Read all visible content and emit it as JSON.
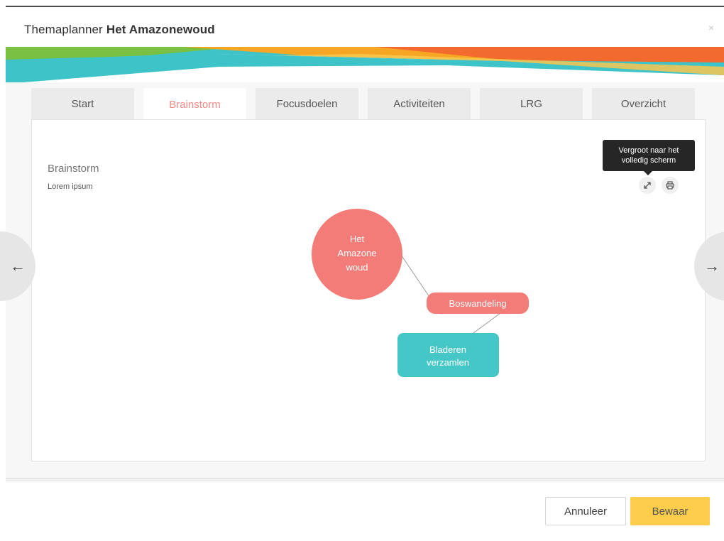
{
  "header": {
    "title_prefix": "Themaplanner",
    "title_main": "Het Amazonewoud",
    "close_label": "×"
  },
  "tabs": [
    {
      "label": "Start"
    },
    {
      "label": "Brainstorm"
    },
    {
      "label": "Focusdoelen"
    },
    {
      "label": "Activiteiten"
    },
    {
      "label": "LRG"
    },
    {
      "label": "Overzicht"
    }
  ],
  "active_tab": "Brainstorm",
  "content": {
    "title": "Brainstorm",
    "subtitle": "Lorem ipsum",
    "tooltip_line1": "Vergroot naar het",
    "tooltip_line2": "volledig scherm",
    "expand_icon": "expand-icon",
    "print_icon": "print-icon"
  },
  "mindmap": {
    "center": {
      "line1": "Het",
      "line2": "Amazone",
      "line3": "woud",
      "color": "#f47c78"
    },
    "node1": {
      "label": "Boswandeling",
      "color": "#f47c78"
    },
    "node2": {
      "line1": "Bladeren",
      "line2": "verzamlen",
      "color": "#45c6c7"
    }
  },
  "nav": {
    "prev_icon": "arrow-left-icon",
    "next_icon": "arrow-right-icon",
    "prev_glyph": "←",
    "next_glyph": "→"
  },
  "footer": {
    "cancel_label": "Annuleer",
    "save_label": "Bewaar"
  },
  "colors": {
    "accent": "#f28b87",
    "save": "#fbcd4a",
    "teal": "#45c6c7"
  }
}
